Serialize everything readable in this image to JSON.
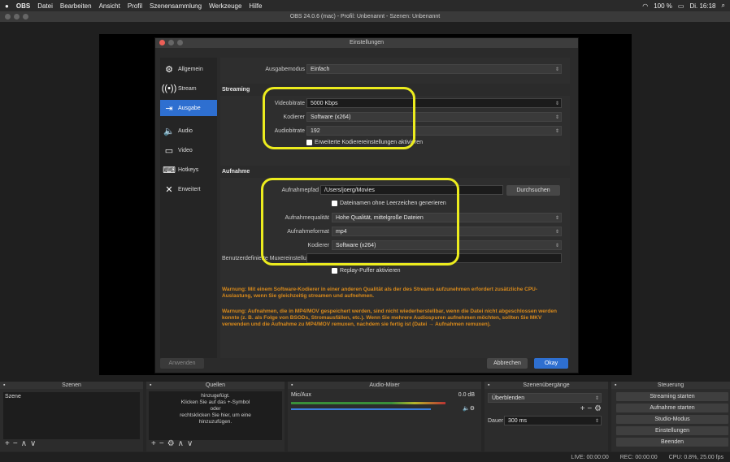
{
  "menubar": {
    "apple": "",
    "app": "OBS",
    "items": [
      "Datei",
      "Bearbeiten",
      "Ansicht",
      "Profil",
      "Szenensammlung",
      "Werkzeuge",
      "Hilfe"
    ],
    "battery": "100 %",
    "clock": "Di. 16:18"
  },
  "window_title": "OBS 24.0.6 (mac) - Profil: Unbenannt - Szenen: Unbenannt",
  "dialog": {
    "title": "Einstellungen",
    "sidebar": [
      {
        "label": "Allgemein",
        "icon": "gear-icon"
      },
      {
        "label": "Stream",
        "icon": "broadcast-icon"
      },
      {
        "label": "Ausgabe",
        "icon": "output-icon"
      },
      {
        "label": "Audio",
        "icon": "speaker-icon"
      },
      {
        "label": "Video",
        "icon": "monitor-icon"
      },
      {
        "label": "Hotkeys",
        "icon": "keyboard-icon"
      },
      {
        "label": "Erweitert",
        "icon": "tools-icon"
      }
    ],
    "ausgabemodus_label": "Ausgabemodus",
    "ausgabemodus_value": "Einfach",
    "streaming_header": "Streaming",
    "videobitrate_label": "Videobitrate",
    "videobitrate_value": "5000 Kbps",
    "kodierer_label": "Kodierer",
    "kodierer_value": "Software (x264)",
    "audiobitrate_label": "Audiobitrate",
    "audiobitrate_value": "192",
    "advanced_encoder_label": "Erweiterte Kodierereinstellungen aktivieren",
    "aufnahme_header": "Aufnahme",
    "aufnahmepfad_label": "Aufnahmepfad",
    "aufnahmepfad_value": "/Users/joerg/Movies",
    "browse_label": "Durchsuchen",
    "nospace_label": "Dateinamen ohne Leerzeichen generieren",
    "quality_label": "Aufnahmequalität",
    "quality_value": "Hohe Qualität, mittelgroße Dateien",
    "format_label": "Aufnahmeformat",
    "format_value": "mp4",
    "rec_kodierer_label": "Kodierer",
    "rec_kodierer_value": "Software (x264)",
    "muxer_label": "Benutzerdefinierte Muxereinstellungen",
    "muxer_value": "",
    "replay_label": "Replay-Puffer aktivieren",
    "warn1": "Warnung: Mit einem Software-Kodierer in einer anderen Qualität als der des Streams aufzunehmen erfordert zusätzliche CPU-Auslastung, wenn Sie gleichzeitig streamen und aufnehmen.",
    "warn2": "Warnung: Aufnahmen, die in MP4/MOV gespeichert werden, sind nicht wiederherstellbar, wenn die Datei nicht abgeschlossen werden konnte (z. B. als Folge von BSODs, Stromausfällen, etc.). Wenn Sie mehrere Audiospuren aufnehmen möchten, sollten Sie MKV verwenden und die Aufnahme zu MP4/MOV remuxen, nachdem sie fertig ist (Datei → Aufnahmen remuxen).",
    "apply_label": "Anwenden",
    "cancel_label": "Abbrechen",
    "ok_label": "Okay"
  },
  "docks": {
    "szenen": {
      "title": "Szenen",
      "item": "Szene"
    },
    "quellen": {
      "title": "Quellen",
      "help": "hinzugefügt.\nKlicken Sie auf das +-Symbol\noder\nrechtsklicken Sie hier, um eine\nhinzuzufügen."
    },
    "mixer": {
      "title": "Audio-Mixer",
      "channel": "Mic/Aux",
      "level": "0.0 dB"
    },
    "transitions": {
      "title": "Szenenübergänge",
      "type": "Überblenden",
      "duration_label": "Dauer",
      "duration_value": "300 ms"
    },
    "controls": {
      "title": "Steuerung",
      "buttons": [
        "Streaming starten",
        "Aufnahme starten",
        "Studio-Modus",
        "Einstellungen",
        "Beenden"
      ]
    }
  },
  "status": {
    "live": "LIVE: 00:00:00",
    "rec": "REC: 00:00:00",
    "cpu": "CPU: 0.8%, 25.00 fps"
  }
}
